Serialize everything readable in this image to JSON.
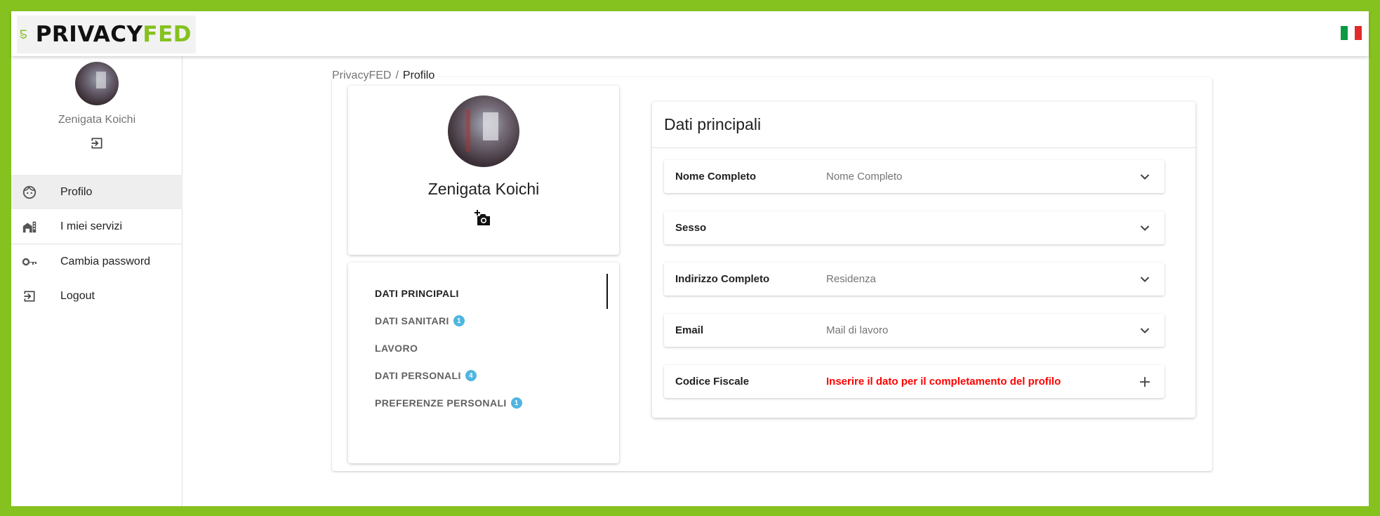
{
  "app": {
    "logo_part1": "PRIVACY",
    "logo_part2": "FED",
    "brand_color": "#85c11f",
    "language_flag": "italy-flag"
  },
  "sidebar": {
    "user_name": "Zenigata Koichi",
    "items": [
      {
        "label": "Profilo",
        "icon": "face-icon",
        "active": true
      },
      {
        "label": "I miei servizi",
        "icon": "buildings-icon",
        "active": false
      },
      {
        "label": "Cambia password",
        "icon": "key-icon",
        "active": false
      },
      {
        "label": "Logout",
        "icon": "logout-icon",
        "active": false
      }
    ]
  },
  "breadcrumb": {
    "root": "PrivacyFED",
    "separator": "/",
    "current": "Profilo"
  },
  "profile": {
    "name": "Zenigata Koichi",
    "camera_icon": "add-photo-icon"
  },
  "sections": [
    {
      "label": "DATI PRINCIPALI",
      "badge": null,
      "active": true
    },
    {
      "label": "DATI SANITARI",
      "badge": "1",
      "active": false
    },
    {
      "label": "LAVORO",
      "badge": null,
      "active": false
    },
    {
      "label": "DATI PERSONALI",
      "badge": "4",
      "active": false
    },
    {
      "label": "PREFERENZE PERSONALI",
      "badge": "1",
      "active": false
    }
  ],
  "badge_color": "#4fb6e0",
  "main": {
    "title": "Dati principali",
    "fields": [
      {
        "label": "Nome Completo",
        "value": "Nome Completo",
        "action": "chevron-down-icon",
        "error": false
      },
      {
        "label": "Sesso",
        "value": "",
        "action": "chevron-down-icon",
        "error": false
      },
      {
        "label": "Indirizzo Completo",
        "value": "Residenza",
        "action": "chevron-down-icon",
        "error": false
      },
      {
        "label": "Email",
        "value": "Mail di lavoro",
        "action": "chevron-down-icon",
        "error": false
      },
      {
        "label": "Codice Fiscale",
        "value": "Inserire il dato per il completamento del profilo",
        "action": "plus-icon",
        "error": true
      }
    ],
    "error_color": "#ff0000"
  }
}
